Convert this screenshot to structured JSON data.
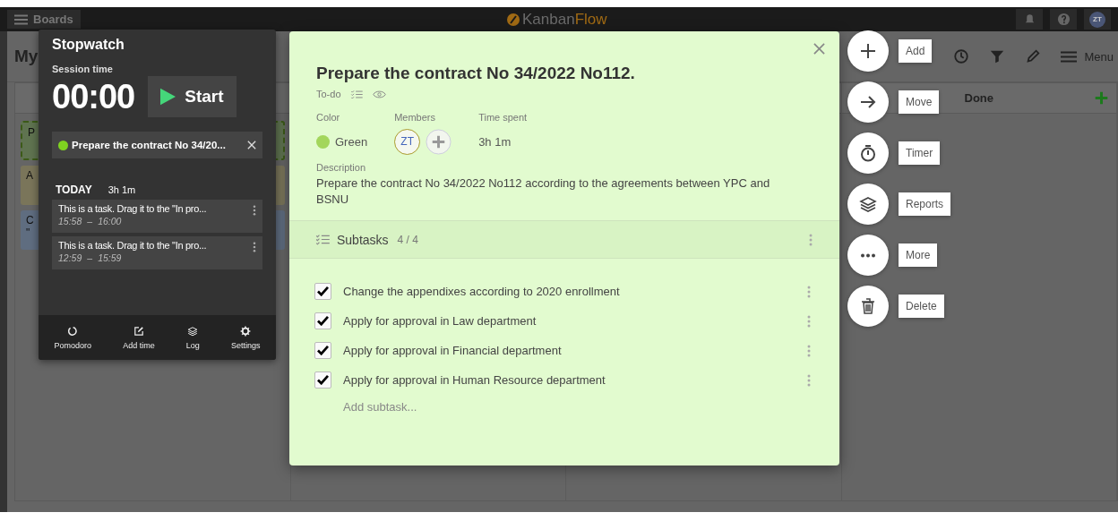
{
  "top_bar": {
    "boards_label": "Boards",
    "logo": {
      "first": "Kanban",
      "second": "Flow"
    },
    "avatar": "ZT"
  },
  "board": {
    "title": "My",
    "menu_label": "Menu",
    "columns": [
      {
        "cards": [
          {
            "line_1": "P",
            "color": "#5f7350",
            "dashed": true
          },
          {
            "line_1": "A",
            "color": "#7a755a",
            "dashed": false
          },
          {
            "line_1": "C",
            "line_2": "\"",
            "color": "#5f6d80",
            "dashed": false
          }
        ]
      },
      {},
      {},
      {
        "header": "Done"
      }
    ]
  },
  "stopwatch": {
    "title": "Stopwatch",
    "session_label": "Session time",
    "time": "00:00",
    "start_label": "Start",
    "task": {
      "text": "Prepare the contract No 34/20...",
      "color": "#7fd320"
    },
    "today": {
      "label": "TODAY",
      "total": "3h 1m"
    },
    "entries": [
      {
        "title": "This is a task. Drag it to the \"In pro...",
        "time_from": "15:58",
        "separator": "–",
        "time_to": "16:00"
      },
      {
        "title": "This is a task. Drag it to the \"In pro...",
        "time_from": "12:59",
        "separator": "–",
        "time_to": "15:59"
      }
    ],
    "footer": [
      {
        "label": "Pomodoro"
      },
      {
        "label": "Add time"
      },
      {
        "label": "Log"
      },
      {
        "label": "Settings"
      }
    ]
  },
  "task_modal": {
    "title": "Prepare the contract No 34/2022 No112.",
    "column": "To-do",
    "color_field": {
      "label": "Color",
      "value": "Green",
      "color": "#a3d65c"
    },
    "members_field": {
      "label": "Members",
      "avatars": [
        "ZT"
      ]
    },
    "time_field": {
      "label": "Time spent",
      "value": "3h 1m"
    },
    "description": {
      "label": "Description",
      "text": "Prepare the contract No 34/2022 No112 according to the agreements between YPC and BSNU"
    },
    "subtasks": {
      "label": "Subtasks",
      "count": "4 / 4",
      "items": [
        {
          "text": "Change the appendixes according to 2020 enrollment",
          "checked": true
        },
        {
          "text": "Apply for approval in Law department",
          "checked": true
        },
        {
          "text": "Apply for approval in Financial department",
          "checked": true
        },
        {
          "text": "Apply for approval in Human Resource department",
          "checked": true
        }
      ],
      "add_placeholder": "Add subtask..."
    }
  },
  "actions": [
    {
      "label": "Add"
    },
    {
      "label": "Move"
    },
    {
      "label": "Timer"
    },
    {
      "label": "Reports"
    },
    {
      "label": "More"
    },
    {
      "label": "Delete"
    }
  ]
}
